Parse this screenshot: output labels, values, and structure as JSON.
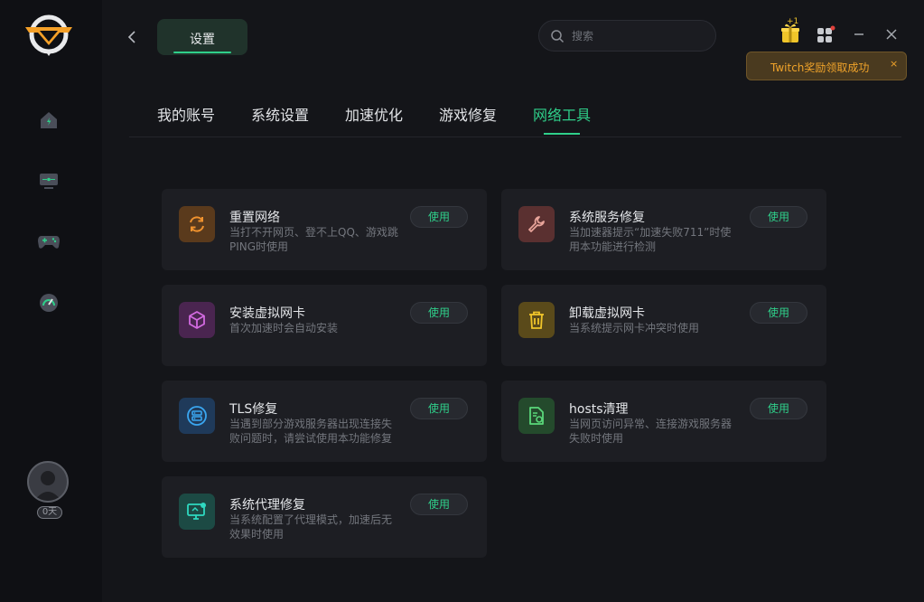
{
  "header": {
    "title_tab": "设置",
    "search_placeholder": "搜索",
    "gift_badge": "+1"
  },
  "toast": {
    "text": "Twitch奖励领取成功",
    "close": "×"
  },
  "sidebar": {
    "days": "0天",
    "items": [
      {
        "name": "home-icon"
      },
      {
        "name": "monitor-icon"
      },
      {
        "name": "gamepad-icon"
      },
      {
        "name": "speed-gauge-icon"
      }
    ]
  },
  "tabs": [
    "我的账号",
    "系统设置",
    "加速优化",
    "游戏修复",
    "网络工具"
  ],
  "active_tab": "网络工具",
  "tools": [
    {
      "title": "重置网络",
      "desc": "当打不开网页、登不上QQ、游戏跳PING时使用",
      "button": "使用",
      "icon": "refresh-icon",
      "icon_bg": "#5a3a1c",
      "icon_color": "#f0922e"
    },
    {
      "title": "系统服务修复",
      "desc": "当加速器提示“加速失败711”时使用本功能进行检测",
      "button": "使用",
      "icon": "wrench-icon",
      "icon_bg": "#5a3030",
      "icon_color": "#e8a49a"
    },
    {
      "title": "安装虚拟网卡",
      "desc": "首次加速时会自动安装",
      "button": "使用",
      "icon": "cube-icon",
      "icon_bg": "#4a2550",
      "icon_color": "#d26ae0"
    },
    {
      "title": "卸载虚拟网卡",
      "desc": "当系统提示网卡冲突时使用",
      "button": "使用",
      "icon": "trash-icon",
      "icon_bg": "#5a4a1a",
      "icon_color": "#f0c52a"
    },
    {
      "title": "TLS修复",
      "desc": "当遇到部分游戏服务器出现连接失败问题时，请尝试使用本功能修复",
      "button": "使用",
      "icon": "server-icon",
      "icon_bg": "#1f3a5a",
      "icon_color": "#3aa6f0"
    },
    {
      "title": "hosts清理",
      "desc": "当网页访问异常、连接游戏服务器失败时使用",
      "button": "使用",
      "icon": "file-clean-icon",
      "icon_bg": "#244a2c",
      "icon_color": "#5ad77a"
    },
    {
      "title": "系统代理修复",
      "desc": "当系统配置了代理模式，加速后无效果时使用",
      "button": "使用",
      "icon": "monitor-fix-icon",
      "icon_bg": "#1c4a44",
      "icon_color": "#2fd9c0"
    }
  ],
  "colors": {
    "accent": "#2fcf8a",
    "warning": "#f0a32a"
  }
}
